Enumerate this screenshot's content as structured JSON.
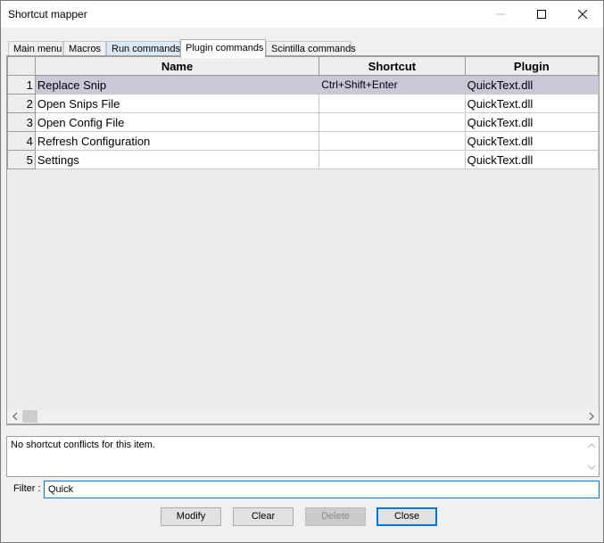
{
  "window": {
    "title": "Shortcut mapper",
    "controls": [
      "minimize-icon",
      "maximize-icon",
      "close-icon"
    ]
  },
  "tabs": [
    {
      "label": "Main menu",
      "state": "normal"
    },
    {
      "label": "Macros",
      "state": "normal"
    },
    {
      "label": "Run commands",
      "state": "hover"
    },
    {
      "label": "Plugin commands",
      "state": "active"
    },
    {
      "label": "Scintilla commands",
      "state": "normal"
    }
  ],
  "grid": {
    "columns": [
      "",
      "Name",
      "Shortcut",
      "Plugin"
    ],
    "rows": [
      {
        "num": "1",
        "name": "Replace Snip",
        "shortcut": "Ctrl+Shift+Enter",
        "plugin": "QuickText.dll",
        "selected": true
      },
      {
        "num": "2",
        "name": "Open Snips File",
        "shortcut": "",
        "plugin": "QuickText.dll",
        "selected": false
      },
      {
        "num": "3",
        "name": "Open Config File",
        "shortcut": "",
        "plugin": "QuickText.dll",
        "selected": false
      },
      {
        "num": "4",
        "name": "Refresh Configuration",
        "shortcut": "",
        "plugin": "QuickText.dll",
        "selected": false
      },
      {
        "num": "5",
        "name": "Settings",
        "shortcut": "",
        "plugin": "QuickText.dll",
        "selected": false
      }
    ]
  },
  "conflict_message": "No shortcut conflicts for this item.",
  "filter": {
    "label": "Filter :",
    "value": "Quick"
  },
  "buttons": {
    "modify": "Modify",
    "clear": "Clear",
    "delete": "Delete",
    "close": "Close"
  },
  "colors": {
    "selected_row": "#c8c8d8",
    "focus_border": "#0078d7",
    "hover_tab": "#dbe9f7"
  }
}
